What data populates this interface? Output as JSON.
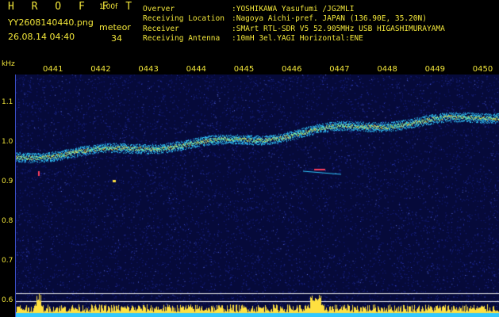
{
  "header": {
    "brand": "H R O F F T",
    "version": "1.00f",
    "filename": "YY2608140440.png",
    "datetime": "26.08.14 04:40",
    "meteor_label": "meteor",
    "meteor_count": "34"
  },
  "metadata": [
    {
      "key": "Overver",
      "value": ":YOSHIKAWA Yasufumi /JG2MLI"
    },
    {
      "key": "Receiving Location",
      "value": ":Nagoya Aichi-pref. JAPAN (136.90E, 35.20N)"
    },
    {
      "key": "Receiver",
      "value": ":SMArt RTL-SDR V5 52.905MHz USB HIGASHIMURAYAMA"
    },
    {
      "key": "Receiving Antenna",
      "value": ":10mH 3el.YAGI Horizontal:ENE"
    }
  ],
  "axis": {
    "unit": "kHz",
    "y_ticks": [
      {
        "label": "1.1",
        "value": 1.1
      },
      {
        "label": "1.0",
        "value": 1.0
      },
      {
        "label": "0.9",
        "value": 0.9
      },
      {
        "label": "0.8",
        "value": 0.8
      },
      {
        "label": "0.7",
        "value": 0.7
      },
      {
        "label": "0.6",
        "value": 0.6
      }
    ],
    "x_ticks": [
      "0441",
      "0442",
      "0443",
      "0444",
      "0445",
      "0446",
      "0447",
      "0448",
      "0449",
      "0450"
    ]
  },
  "colors": {
    "text": "#f2e63a",
    "background": "#060a3a",
    "signal_core": "#ffe040",
    "signal_halo": "#30c8ff",
    "noise": "#3848d0",
    "meteor": "#ff4060",
    "baseline": "#e8e8e8"
  }
}
